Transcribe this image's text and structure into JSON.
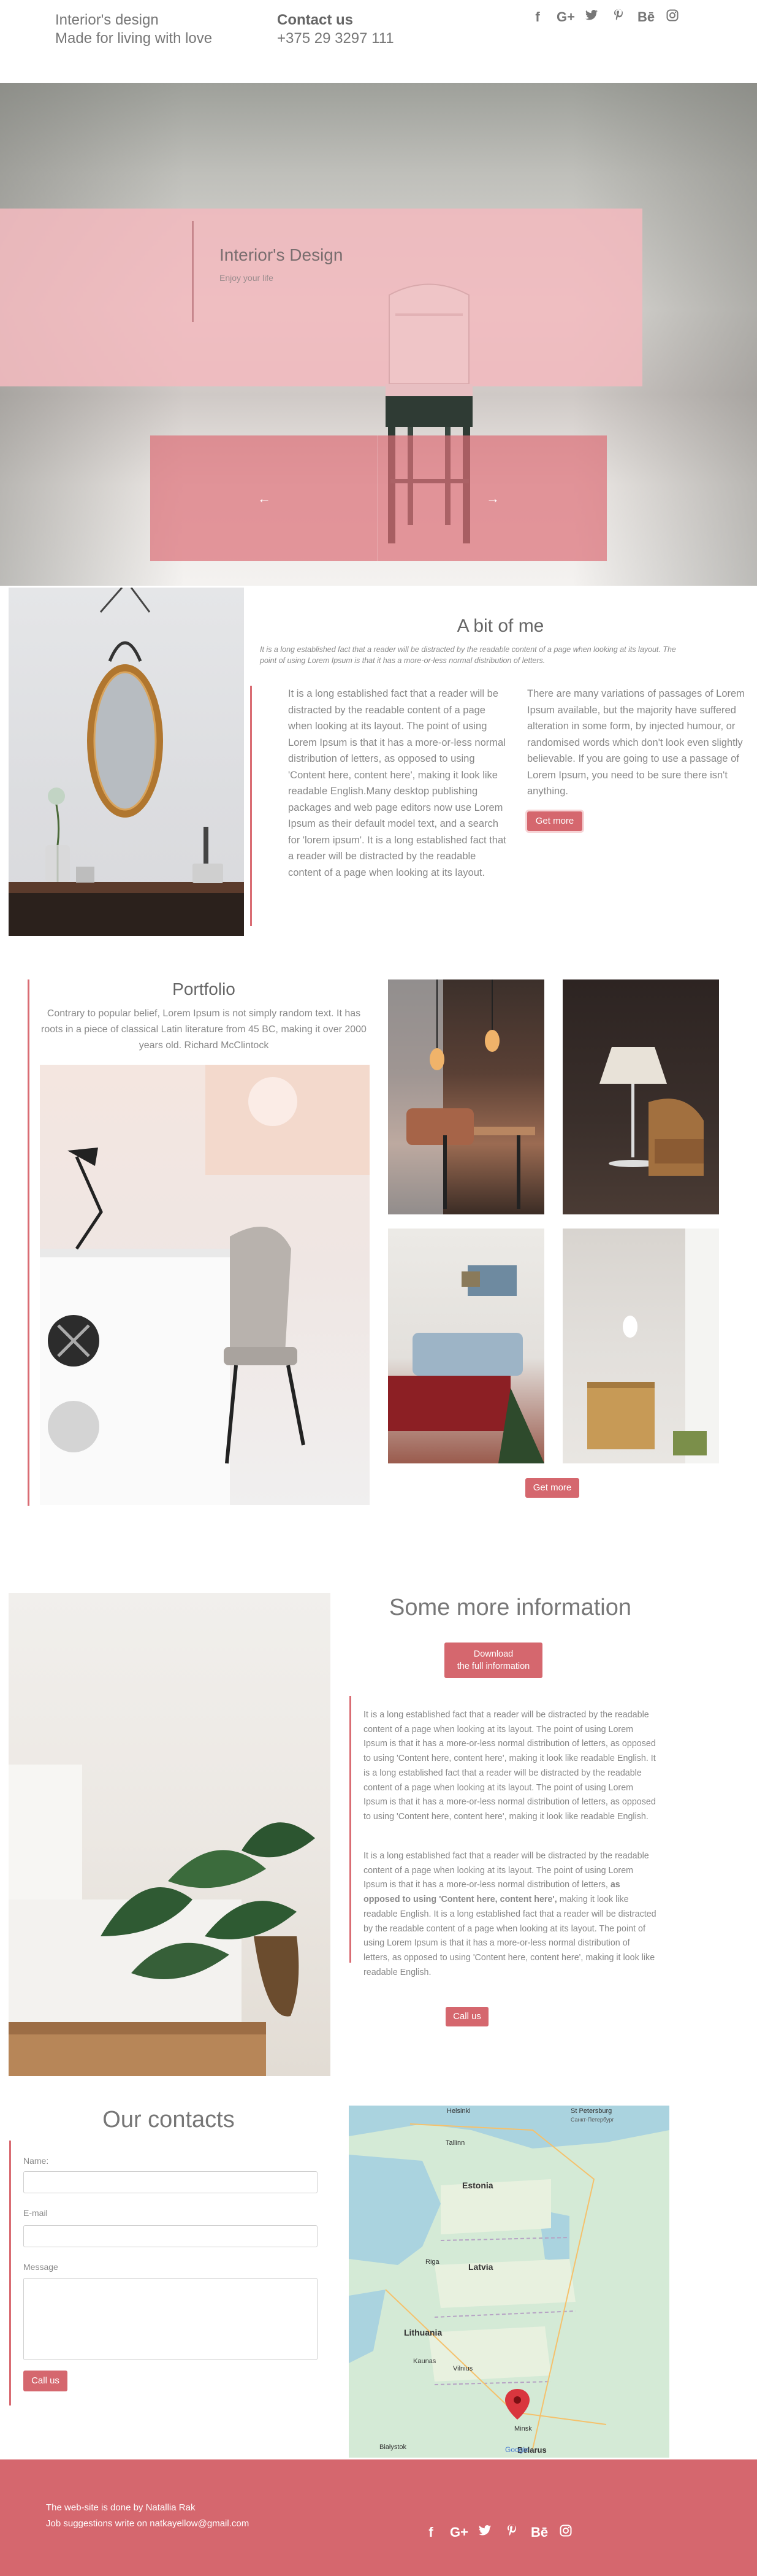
{
  "header": {
    "brand_line1": "Interior's design",
    "brand_line2": "Made for living with love",
    "contact_title": "Contact us",
    "phone": "+375 29 3297 111"
  },
  "social": [
    {
      "name": "facebook-icon",
      "glyph": "f"
    },
    {
      "name": "google-plus-icon",
      "glyph": "G+"
    },
    {
      "name": "twitter-icon",
      "glyph": "🐦"
    },
    {
      "name": "pinterest-icon",
      "glyph": "℗"
    },
    {
      "name": "behance-icon",
      "glyph": "Bē"
    },
    {
      "name": "instagram-icon",
      "glyph": "◎"
    }
  ],
  "hero": {
    "title": "Interior's Design",
    "subtitle": "Enjoy your life",
    "prev_arrow": "←",
    "next_arrow": "→"
  },
  "about": {
    "title": "A bit of me",
    "intro": "It is a long established fact that a reader will be distracted by the readable content of a page when looking at its layout. The point of using Lorem Ipsum is that it has a more-or-less normal distribution of letters.",
    "col1": "It is a long established fact that a reader will be distracted by the readable content of a page when looking at its layout. The point of using Lorem Ipsum is that it has a more-or-less normal distribution of letters, as opposed to using 'Content here, content here', making it look like readable English.Many desktop publishing packages and web page editors now use Lorem Ipsum as their default model text, and a search for 'lorem ipsum'. It is a long established fact that a reader will be distracted by the readable content of a page when looking at its layout.",
    "col2": "There are many variations of passages of Lorem Ipsum available, but the majority have suffered alteration in some form, by injected humour, or randomised words which don't look even slightly believable. If you are going to use a passage of Lorem Ipsum, you need to be sure there isn't anything.",
    "button": "Get more"
  },
  "portfolio": {
    "title": "Portfolio",
    "quote": "Contrary to popular belief, Lorem Ipsum is not simply random text. It has roots in a piece of classical Latin literature from 45 BC, making it over 2000 years old. Richard McClintock",
    "button": "Get more"
  },
  "info": {
    "title": "Some more information",
    "download_line1": "Download",
    "download_line2": "the full information",
    "para1": "It is a long established fact that a reader will be distracted by the readable content of a page when looking at its layout. The point of using Lorem Ipsum is that it has a more-or-less normal distribution of letters, as opposed to using 'Content here, content here', making it look like readable English. It is a long established fact that a reader will be distracted by the readable content of a page when looking at its layout. The point of using Lorem Ipsum is that it has a more-or-less normal distribution of letters, as opposed to using 'Content here, content here', making it look like readable English.",
    "para2_a": "It is a long established fact that a reader will be distracted by the readable content of a page when looking at its layout. The point of using Lorem Ipsum is that it has a more-or-less normal distribution of letters,",
    "para2_bold": "as opposed to using 'Content here, content here',",
    "para2_b": "making it look like readable English. It is a long established fact that a reader will be distracted by the readable content of a page when looking at its layout. The point of using Lorem Ipsum is that it has a more-or-less normal distribution of letters, as opposed to using 'Content here, content here', making it look like readable English.",
    "button": "Call us"
  },
  "contacts": {
    "title": "Our contacts",
    "name_label": "Name:",
    "email_label": "E-mail",
    "message_label": "Message",
    "button": "Call us"
  },
  "map": {
    "labels": [
      "Helsinki",
      "St Petersburg",
      "Санкт-Петербург",
      "Tallinn",
      "Estonia",
      "Latvia",
      "Riga",
      "Lithuania",
      "Kaunas",
      "Vilnius",
      "Minsk",
      "Belarus",
      "Białystok"
    ],
    "logo": "Google"
  },
  "footer": {
    "line1": "The web-site is done by Natallia Rak",
    "line2": "Job suggestions write on natkayellow@gmail.com"
  },
  "colors": {
    "accent": "#d5676e",
    "hero_pink": "#f1babe"
  }
}
